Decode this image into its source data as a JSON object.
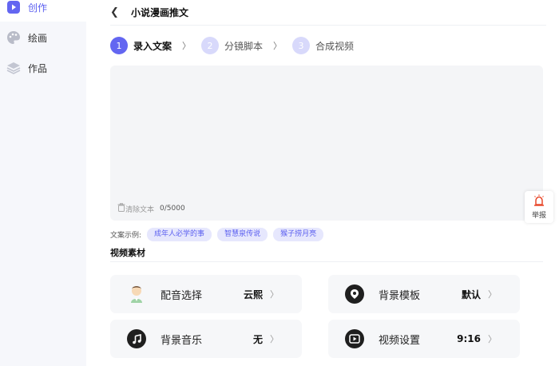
{
  "sidebar": {
    "items": [
      {
        "label": "创作",
        "icon": "play-square-icon",
        "active": true
      },
      {
        "label": "绘画",
        "icon": "palette-icon",
        "active": false
      },
      {
        "label": "作品",
        "icon": "layers-icon",
        "active": false
      }
    ]
  },
  "header": {
    "title": "小说漫画推文"
  },
  "steps": [
    {
      "num": "1",
      "label": "录入文案"
    },
    {
      "num": "2",
      "label": "分镜脚本"
    },
    {
      "num": "3",
      "label": "合成视频"
    }
  ],
  "editor": {
    "clear_label": "清除文本",
    "count": "0/5000"
  },
  "examples": {
    "label": "文案示例:",
    "tags": [
      "成年人必学的事",
      "智慧泉传说",
      "猴子捞月亮"
    ]
  },
  "section_title": "视频素材",
  "cards": [
    {
      "label": "配音选择",
      "value": "云熙",
      "icon": "avatar-icon"
    },
    {
      "label": "背景模板",
      "value": "默认",
      "icon": "template-icon"
    },
    {
      "label": "背景音乐",
      "value": "无",
      "icon": "music-icon"
    },
    {
      "label": "视频设置",
      "value": "9:16",
      "icon": "video-settings-icon"
    }
  ],
  "report": {
    "label": "举报"
  },
  "colors": {
    "accent": "#6366f1",
    "accent_light": "#d8d9fb",
    "report_icon": "#e8492b"
  }
}
